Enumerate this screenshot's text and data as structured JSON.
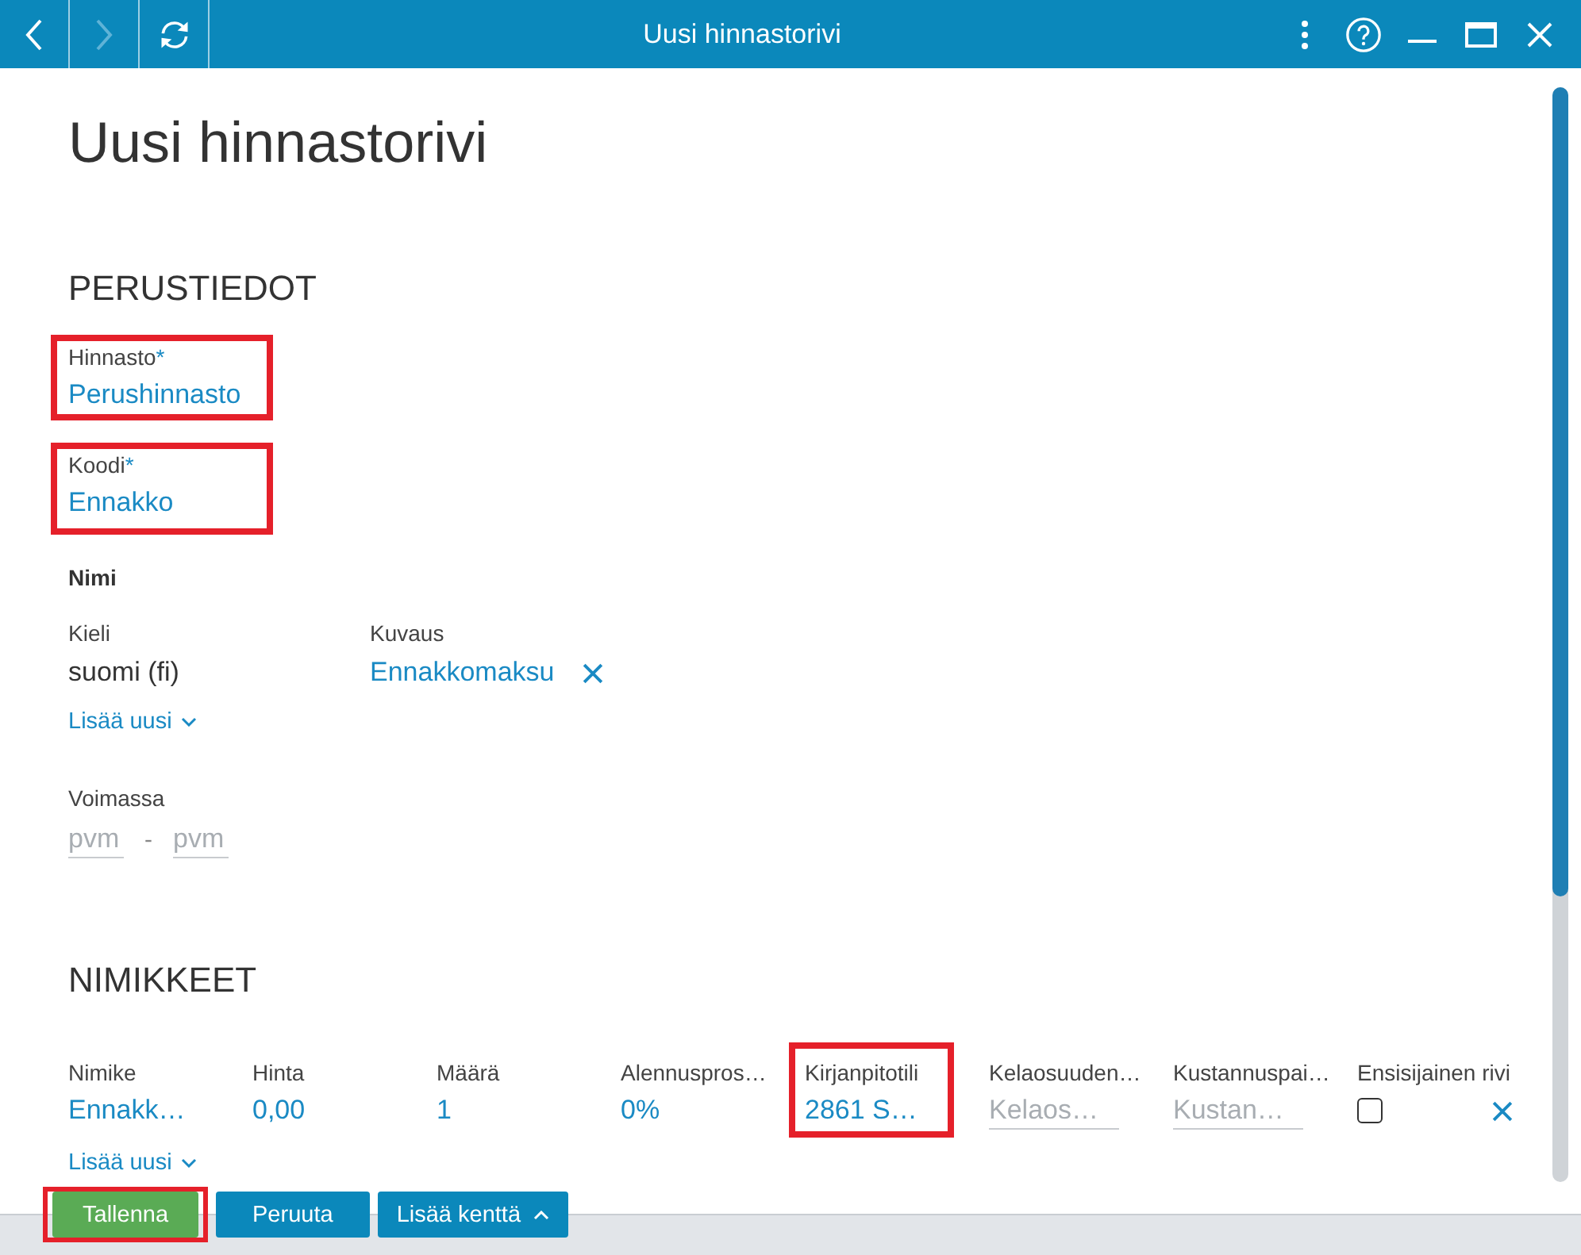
{
  "titlebar": {
    "nav_buttons": [
      {
        "kind": "back",
        "disabled": false
      },
      {
        "kind": "forward",
        "disabled": true
      },
      {
        "kind": "refresh",
        "disabled": false
      }
    ],
    "title": "Uusi hinnastorivi",
    "window_controls": [
      {
        "kind": "more"
      },
      {
        "kind": "help"
      },
      {
        "kind": "minimize"
      },
      {
        "kind": "maximize"
      },
      {
        "kind": "close"
      }
    ]
  },
  "page": {
    "title": "Uusi hinnastorivi"
  },
  "perustiedot": {
    "heading": "PERUSTIEDOT",
    "fields": [
      {
        "label": "Hinnasto",
        "required_mark": "*",
        "value": "Perushinnasto",
        "highlighted": true
      },
      {
        "label": "Koodi",
        "required_mark": "*",
        "value": "Ennakko",
        "highlighted": true
      }
    ],
    "nimi": {
      "heading": "Nimi",
      "columns": [
        "Kieli",
        "Kuvaus"
      ],
      "rows": [
        {
          "kieli": "suomi (fi)",
          "kuvaus": "Ennakkomaksu"
        }
      ],
      "add_button": "Lisää uusi"
    },
    "voimassa": {
      "label": "Voimassa",
      "from": {
        "placeholder": "pvm"
      },
      "separator": "-",
      "to": {
        "placeholder": "pvm"
      }
    }
  },
  "nimikkeet": {
    "heading": "NIMIKKEET",
    "columns": [
      {
        "label": "Nimike",
        "highlighted": false
      },
      {
        "label": "Hinta",
        "highlighted": false
      },
      {
        "label": "Määrä",
        "highlighted": false
      },
      {
        "label": "Alennuspros…",
        "highlighted": false
      },
      {
        "label": "Kirjanpitotili",
        "highlighted": true
      },
      {
        "label": "Kelaosuuden…",
        "highlighted": false
      },
      {
        "label": "Kustannuspai…",
        "highlighted": false
      },
      {
        "label": "Ensisijainen rivi",
        "highlighted": false
      }
    ],
    "rows": [
      {
        "cells": [
          {
            "kind": "link",
            "text": "Ennakk…"
          },
          {
            "kind": "link",
            "text": "0,00"
          },
          {
            "kind": "link",
            "text": "1"
          },
          {
            "kind": "link",
            "text": "0%"
          },
          {
            "kind": "link",
            "text": "2861 S…"
          },
          {
            "kind": "input",
            "placeholder": "Kelaos…"
          },
          {
            "kind": "input",
            "placeholder": "Kustan…"
          },
          {
            "kind": "checkbox",
            "checked": false
          }
        ]
      }
    ],
    "add_button": "Lisää uusi"
  },
  "footer": {
    "buttons": [
      {
        "kind": "primary",
        "label": "Tallenna",
        "highlighted": true
      },
      {
        "kind": "secondary",
        "label": "Peruuta",
        "highlighted": false
      },
      {
        "kind": "menu",
        "label": "Lisää kenttä",
        "highlighted": false
      }
    ]
  }
}
